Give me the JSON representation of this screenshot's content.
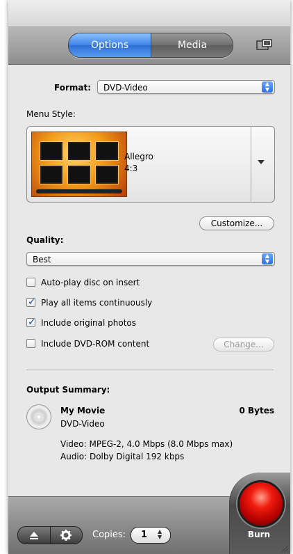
{
  "header": {
    "tabs": [
      {
        "label": "Options",
        "selected": true
      },
      {
        "label": "Media",
        "selected": false
      }
    ],
    "window_button_icon": "window-resize-icon"
  },
  "format": {
    "label": "Format:",
    "value": "DVD-Video"
  },
  "menu_style": {
    "label": "Menu Style:",
    "name": "Allegro",
    "aspect": "4:3",
    "customize_label": "Customize..."
  },
  "quality": {
    "label": "Quality:",
    "value": "Best"
  },
  "checkboxes": [
    {
      "label": "Auto-play disc on insert",
      "checked": false
    },
    {
      "label": "Play all items continuously",
      "checked": true
    },
    {
      "label": "Include original photos",
      "checked": true
    },
    {
      "label": "Include DVD-ROM content",
      "checked": false
    }
  ],
  "change_label": "Change...",
  "summary": {
    "title": "Output Summary:",
    "name": "My Movie",
    "size": "0 Bytes",
    "type": "DVD-Video",
    "video": "Video: MPEG-2, 4.0 Mbps (8.0 Mbps max)",
    "audio": "Audio: Dolby Digital 192 kbps"
  },
  "footer": {
    "copies_label": "Copies:",
    "copies_value": "1",
    "burn_label": "Burn"
  },
  "colors": {
    "accent": "#3d82e6",
    "burn_red": "#f11c10"
  }
}
